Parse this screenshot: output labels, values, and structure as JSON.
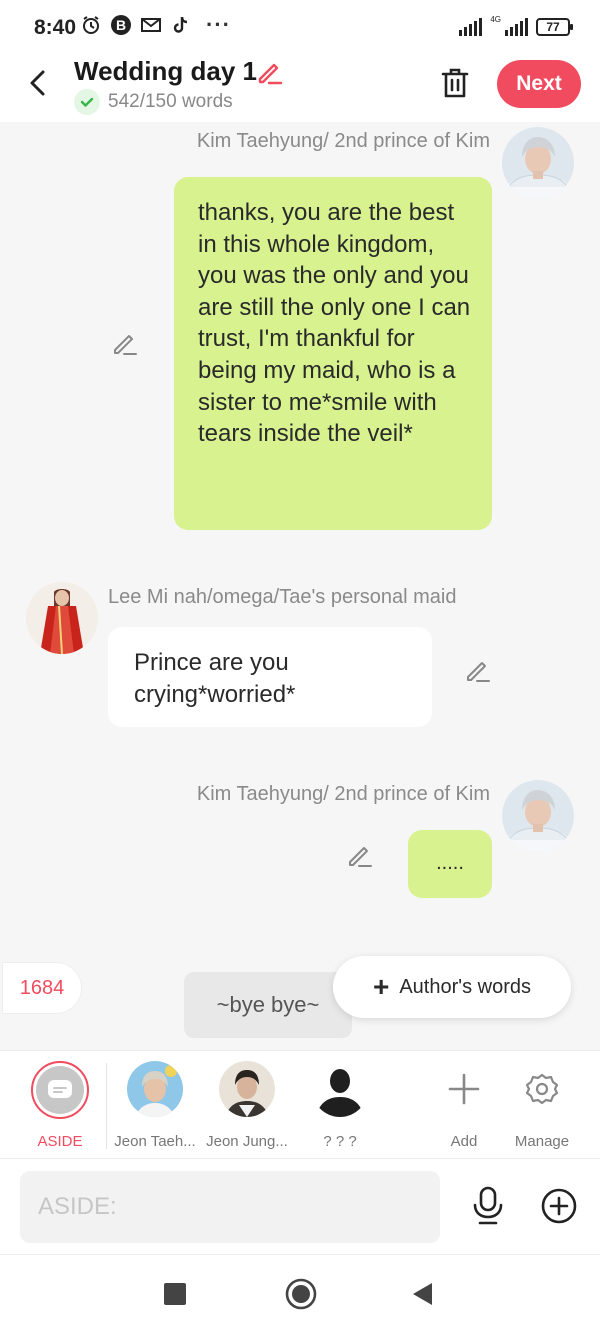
{
  "status_bar": {
    "time": "8:40",
    "icons": [
      "alarm-icon",
      "b-badge-icon",
      "gmail-icon",
      "tiktok-icon"
    ],
    "more": "···",
    "network": "4G",
    "battery": "77"
  },
  "header": {
    "title": "Wedding day 1",
    "word_count": "542/150 words",
    "next_label": "Next"
  },
  "messages": [
    {
      "side": "right",
      "name": "Kim Taehyung/ 2nd prince of Kim",
      "text": "thanks, you are the best in this whole kingdom, you was the only and you are still the only one I can trust, I'm thankful for being my maid, who is a sister to me*smile with tears inside the veil*"
    },
    {
      "side": "left",
      "name": "Lee Mi nah/omega/Tae's personal maid",
      "text": "Prince are you crying*worried*"
    },
    {
      "side": "right",
      "name": "Kim Taehyung/ 2nd prince of Kim",
      "text": "....."
    }
  ],
  "count_badge": "1684",
  "aside_message": "~bye bye~",
  "author_words_label": "Author's words",
  "characters": [
    {
      "label": "ASIDE",
      "active": true
    },
    {
      "label": "Jeon Taeh..."
    },
    {
      "label": "Jeon Jung..."
    },
    {
      "label": "? ? ?"
    },
    {
      "label": "Add"
    },
    {
      "label": "Manage"
    }
  ],
  "input": {
    "placeholder": "ASIDE:"
  },
  "colors": {
    "accent": "#f04b5e",
    "green_bubble": "#d7f28f",
    "background": "#f6f6f6"
  }
}
